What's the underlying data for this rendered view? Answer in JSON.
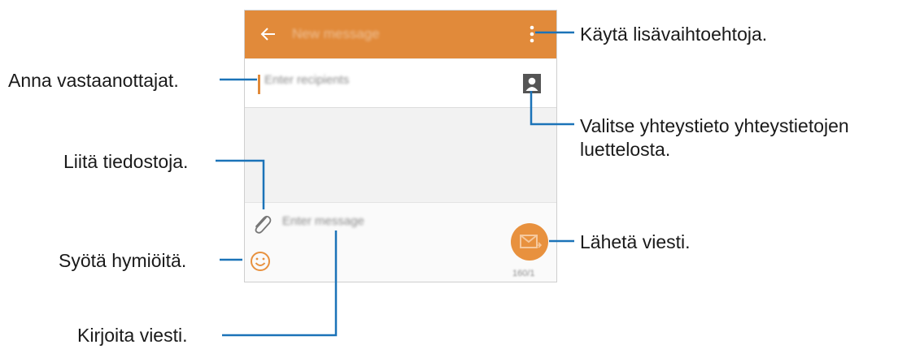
{
  "screen": {
    "title": "New message",
    "recipients_placeholder": "Enter recipients",
    "message_placeholder": "Enter message",
    "char_counter": "160/1"
  },
  "callouts": {
    "more_options": "Käytä lisävaihtoehtoja.",
    "enter_recipients": "Anna vastaanottajat.",
    "select_contact_line1": "Valitse yhteystieto yhteystietojen",
    "select_contact_line2": "luettelosta.",
    "attach_files": "Liitä tiedostoja.",
    "send_message": "Lähetä viesti.",
    "insert_emoticons": "Syötä hymiöitä.",
    "write_message": "Kirjoita viesti."
  },
  "colors": {
    "accent": "#e18a3a",
    "leader_line": "#1b73b8"
  },
  "icons": [
    "back-arrow-icon",
    "more-options-icon",
    "contact-icon",
    "paperclip-icon",
    "emoji-icon",
    "send-envelope-icon"
  ]
}
